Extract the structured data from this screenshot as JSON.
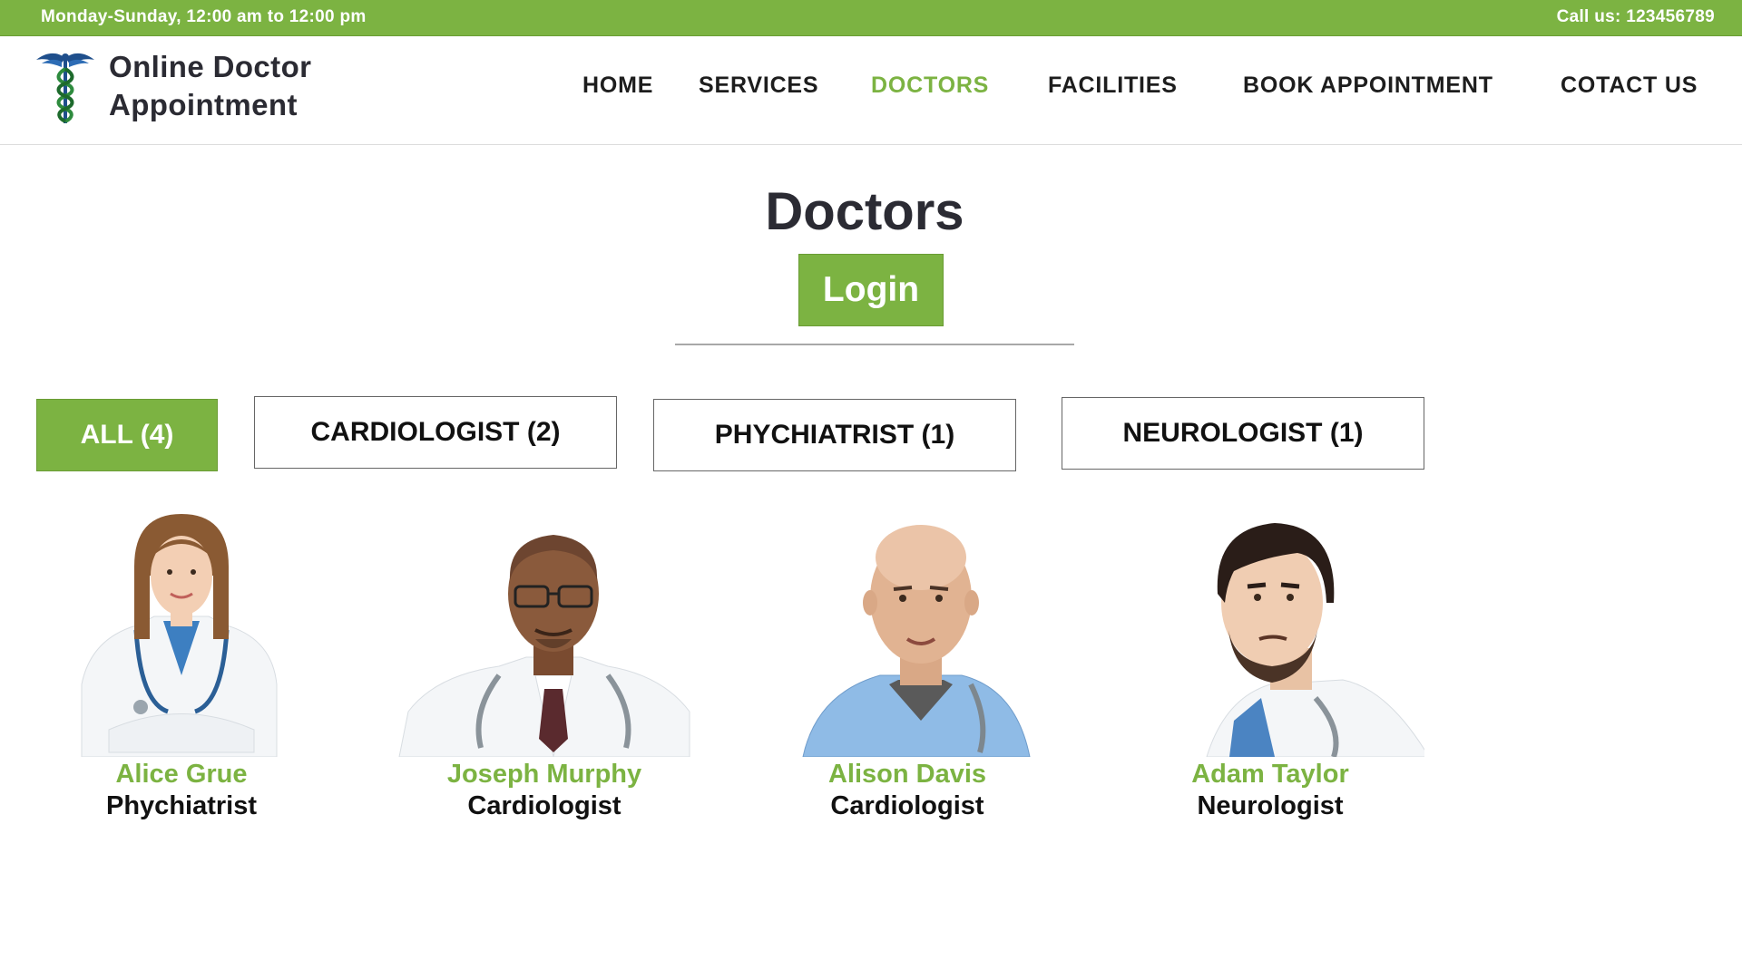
{
  "topbar": {
    "hours": "Monday-Sunday, 12:00 am to 12:00 pm",
    "phone": "Call us: 123456789"
  },
  "brand": {
    "line1": "Online Doctor",
    "line2": "Appointment",
    "icon": "caduceus-icon"
  },
  "nav": [
    {
      "label": "HOME",
      "active": false
    },
    {
      "label": "SERVICES",
      "active": false
    },
    {
      "label": "DOCTORS",
      "active": true
    },
    {
      "label": "FACILITIES",
      "active": false
    },
    {
      "label": "BOOK  APPOINTMENT",
      "active": false
    },
    {
      "label": "COTACT US",
      "active": false
    }
  ],
  "page": {
    "title": "Doctors",
    "login_label": "Login"
  },
  "filters": [
    {
      "label": "ALL (4)",
      "active": true
    },
    {
      "label": "CARDIOLOGIST (2)",
      "active": false
    },
    {
      "label": "PHYCHIATRIST (1)",
      "active": false
    },
    {
      "label": "NEUROLOGIST (1)",
      "active": false
    }
  ],
  "doctors": [
    {
      "name": "Alice Grue",
      "specialty": "Phychiatrist"
    },
    {
      "name": "Joseph Murphy",
      "specialty": "Cardiologist"
    },
    {
      "name": "Alison Davis",
      "specialty": "Cardiologist"
    },
    {
      "name": "Adam Taylor",
      "specialty": "Neurologist"
    }
  ],
  "colors": {
    "accent": "#7cb342",
    "heading": "#2b2b33",
    "text": "#111111"
  }
}
